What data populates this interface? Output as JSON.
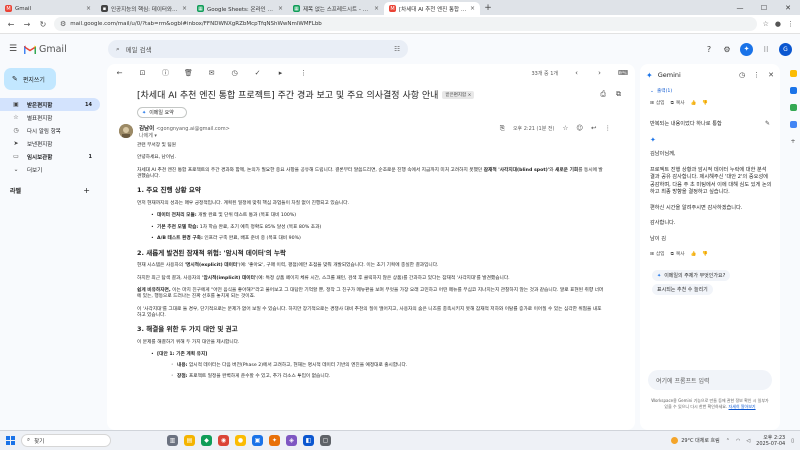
{
  "browser": {
    "tabs": [
      {
        "title": "Gmail",
        "favicon": "gmail-icon",
        "color": "#ea4335"
      },
      {
        "title": "인공지능의 핵심: 데이터와 학습",
        "favicon": "doc-icon",
        "color": "#444444"
      },
      {
        "title": "Google Sheets: 온라인 스프레드시트",
        "favicon": "sheets-icon",
        "color": "#0f9d58"
      },
      {
        "title": "제목 없는 스프레드시트 - Goo",
        "favicon": "sheets-icon",
        "color": "#0f9d58"
      },
      {
        "title": "[차세대 AI 추천 엔진 통합 프로",
        "favicon": "gmail-icon",
        "color": "#ea4335"
      }
    ],
    "url": "mail.google.com/mail/u/0/?tab=rm&ogbl#inbox/FFNDWNXgRZbMcpTfqNShWwNmlWMFLbb"
  },
  "header": {
    "logo_text": "Gmail",
    "search_placeholder": "메일 검색"
  },
  "nav": {
    "compose": "편지쓰기",
    "items": [
      {
        "label": "받은편지함",
        "count": "14",
        "icon": "inbox-icon"
      },
      {
        "label": "별표편지함",
        "count": "",
        "icon": "star-icon"
      },
      {
        "label": "다시 알림 항목",
        "count": "",
        "icon": "clock-icon"
      },
      {
        "label": "보낸편지함",
        "count": "",
        "icon": "send-icon"
      },
      {
        "label": "임시보관함",
        "count": "1",
        "icon": "draft-icon"
      },
      {
        "label": "더보기",
        "count": "",
        "icon": "chevron-down-icon"
      }
    ],
    "labels_title": "라벨"
  },
  "mail": {
    "pagination": "33개 중 1개",
    "subject": "[차세대 AI 추천 엔진 통합 프로젝트] 주간 경과 보고 및 주요 의사결정 사항 안내",
    "label_chip": "받은편지함 ×",
    "summarize": "이메일 요약",
    "sender_name": "김남이",
    "sender_email": "<gongnyang.ai@gmail.com>",
    "to": "나에게 ▾",
    "time": "오후 2:21 (1분 전)",
    "greeting1": "관련 부서장 및 팀원",
    "greeting2": "안녕하세요, 남이님.",
    "intro_a": "차세대 AI 추천 엔진 통합 프로젝트의 주간 경과와 함께, 논의가 필요한 중요 사항을 공유해 드립니다. 결론부터 말씀드리면, 순조로운 진행 속에서 지금까지 미처 고려하지 못했던 ",
    "intro_b": "잠재적 '사각지대(blind spot)'",
    "intro_c": "와 ",
    "intro_d": "새로운 기회",
    "intro_e": "를 동시에 발견했습니다.",
    "h1": "1. 주요 진행 상황 요약",
    "p1": "먼저 현재까지의 성과는 매우 긍정적입니다. 계획된 일정에 맞춰 핵심 과업들이 차질 없이 진행되고 있습니다.",
    "bullets1": [
      {
        "b": "데이터 전처리 모듈:",
        "t": " 개발 완료 및 단위 테스트 통과 (목표 대비 100%)"
      },
      {
        "b": "기본 추천 모델 학습:",
        "t": " 1차 학습 완료, 초기 예측 정확도 85% 달성 (목표 80% 초과)"
      },
      {
        "b": "A/B 테스트 환경 구축:",
        "t": " 인프라 구축 완료, 배포 준비 중 (목표 대비 90%)"
      }
    ],
    "h2": "2. 새롭게 발견된 잠재적 위험: '암시적 데이터'의 누락",
    "p2a": "현재 시스템은 사용자의 ",
    "p2b": "'명시적(explicit) 데이터'",
    "p2c": "(예: '좋아요', 구매 이력, 평점)에만 초점을 맞춰 개발되었습니다. 이는 초기 기획에 충실한 결과입니다.",
    "p3a": "하지만 최근 탐색 결과, 사용자의 ",
    "p3b": "'암시적(implicit) 데이터'",
    "p3c": "(예: 특정 상품 페이지 체류 시간, 스크롤 패턴, 검색 후 클릭하지 않은 상품)를 간과하고 있다는 잠재적 '사각지대'를 발견했습니다.",
    "p4a": "쉽게 비유하자면,",
    "p4b": " 이는 마치 친구에게 \"어떤 음식을 좋아해?\"라고 물어보고 그 대답만 기억할 뿐, 정작 그 친구가 메뉴판을 보며 무엇을 가장 오래 고민하고 어떤 메뉴를 무심코 지나치는지 관찰하지 않는 것과 같습니다. 말로 표현된 취향 너머에 있는, 행동으로 드러나는 진짜 선호를 놓치게 되는 것이죠.",
    "p5": "이 '사각지대'를 그대로 둘 경우, 단기적으로는 문제가 없어 보일 수 있습니다. 하지만 장기적으로는 경쟁사 대비 추천의 질이 떨어지고, 사용자의 숨은 니즈를 충족시키지 못해 잠재적 저하와 이탈률 증가로 이어질 수 있는 심각한 위협을 내포하고 있습니다.",
    "h3": "3. 해결을 위한 두 가지 대안 및 권고",
    "p6": "이 문제를 해결하기 위해 두 가지 대안을 제시합니다.",
    "alt1_title": "[대안 1: 기존 계획 유지]",
    "alt1_items": [
      {
        "b": "내용:",
        "t": " 암시적 데이터는 다음 버전(Phase 2)에서 고려하고, 현재는 명시적 데이터 기반의 엔진을 예정대로 출시합니다."
      },
      {
        "b": "장점:",
        "t": " 프로젝트 일정을 완벽하게 준수할 수 있고, 추가 리소스 투입이 없습니다."
      }
    ]
  },
  "gemini": {
    "title": "Gemini",
    "output_chip": "출력(1)",
    "insert": "삽입",
    "copy": "복사",
    "user_msg": "반복되는 내용이었다 하나로 통합",
    "response": [
      "김남이님께,",
      "프로젝트 진행 상황과 암시적 데이터 누락에 대한 분석 결과 공유 감사합니다. 제시해주신 '대안 2'의 중요성에 공감하며, 다음 주 초 미팅에서 이에 대해 심도 있게 논의하고 최종 방향을 결정하고 싶습니다.",
      "편하신 시간을 알려주시면 감사하겠습니다.",
      "감사합니다.",
      "남이 김"
    ],
    "suggestions": [
      "이메일의 주제가 무엇인가요?",
      "표시되는 추천 수 늘리기"
    ],
    "prompt_placeholder": "여기에 프롬프트 입력",
    "note_a": "Workspace용 Gemini 기능으로 만들 등에 관한 정보 확인 시 일부가 있을 수 있으니 다시 한번 확인하세요. ",
    "note_link": "자세히 알아보기"
  },
  "taskbar": {
    "search": "찾기",
    "weather": "29°C 대체로 흐림",
    "time": "오후 2:23",
    "date": "2025-07-04"
  }
}
